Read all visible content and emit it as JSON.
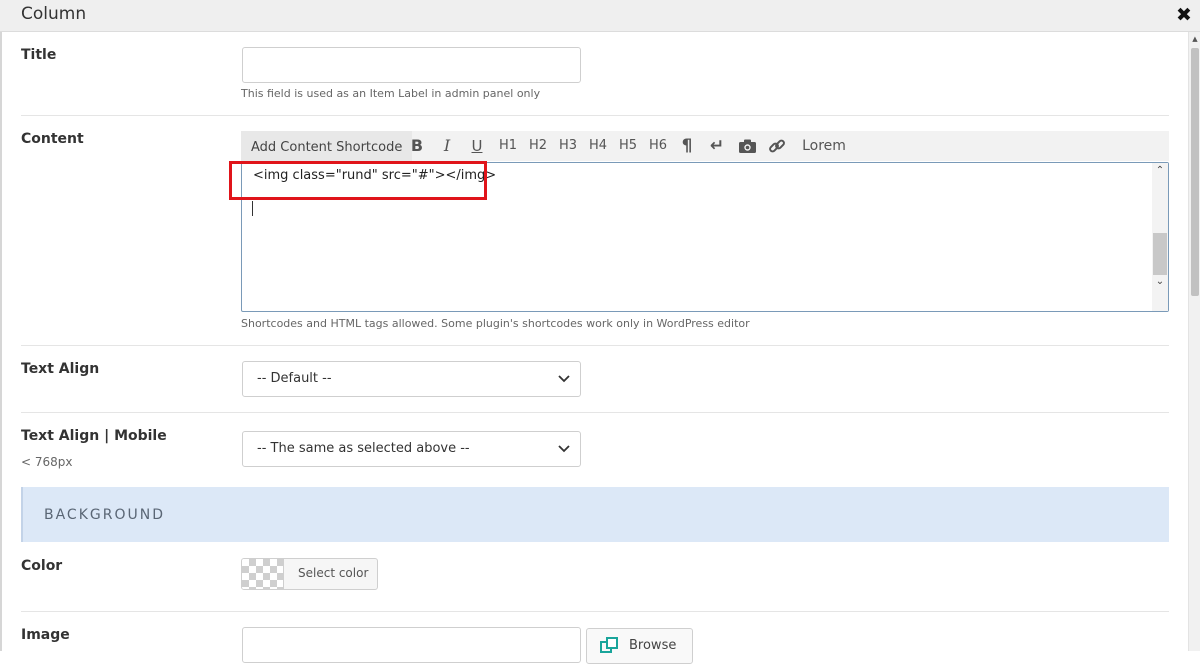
{
  "header": {
    "title": "Column",
    "close_label": "✖"
  },
  "title_field": {
    "label": "Title",
    "value": "",
    "hint": "This field is used as an Item Label in admin panel only"
  },
  "content_field": {
    "label": "Content",
    "toolbar": {
      "shortcode_button": "Add Content Shortcode",
      "bold": "B",
      "italic": "I",
      "underline": "U",
      "h1": "H1",
      "h2": "H2",
      "h3": "H3",
      "h4": "H4",
      "h5": "H5",
      "h6": "H6",
      "paragraph": "¶",
      "linebreak": "↵",
      "lorem": "Lorem"
    },
    "value": "<img class=\"rund\" src=\"#\"></img>",
    "hint": "Shortcodes and HTML tags allowed. Some plugin's shortcodes work only in WordPress editor"
  },
  "text_align": {
    "label": "Text Align",
    "selected": "-- Default --"
  },
  "text_align_mobile": {
    "label": "Text Align | Mobile",
    "sublabel": "< 768px",
    "selected": "-- The same as selected above --"
  },
  "background_section": {
    "title": "BACKGROUND"
  },
  "color_field": {
    "label": "Color",
    "button": "Select color"
  },
  "image_field": {
    "label": "Image",
    "value": "",
    "browse": "Browse"
  },
  "colors": {
    "highlight": "#e0141a",
    "section_bg": "#dce8f7",
    "accent": "#1aa59b"
  }
}
